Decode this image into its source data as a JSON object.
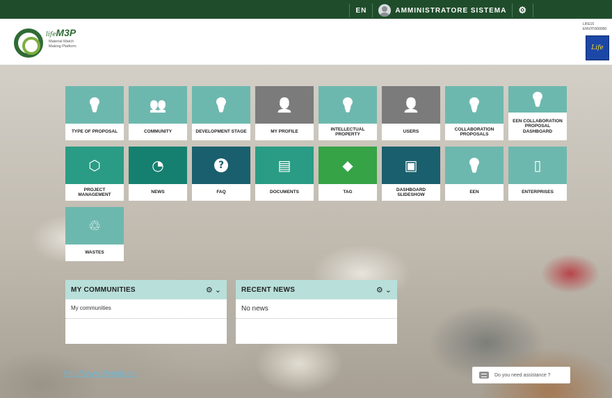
{
  "topbar": {
    "language": "EN",
    "user_name": "AMMINISTRATORE SISTEMA",
    "settings_icon": "gear-icon"
  },
  "header": {
    "logo_title": "M3P",
    "logo_prefix": "life",
    "logo_subtitle": "Material Match Making Platform",
    "eu_text": "LIFE15 ENV/IT/000000",
    "eu_flag_text": "Life"
  },
  "tiles": [
    {
      "label": "TYPE OF PROPOSAL",
      "icon": "lightbulb-icon",
      "color": "#6db8ae"
    },
    {
      "label": "COMMUNITY",
      "icon": "users-icon",
      "color": "#6db8ae"
    },
    {
      "label": "DEVELOPMENT STAGE",
      "icon": "lightbulb-icon",
      "color": "#6db8ae"
    },
    {
      "label": "MY PROFILE",
      "icon": "user-icon",
      "color": "#7b7b7b"
    },
    {
      "label": "INTELLECTUAL PROPERTY",
      "icon": "lightbulb-icon",
      "color": "#6db8ae"
    },
    {
      "label": "USERS",
      "icon": "user-group-icon",
      "color": "#7b7b7b"
    },
    {
      "label": "COLLABORATION PROPOSALS",
      "icon": "lightbulb-icon",
      "color": "#6db8ae"
    },
    {
      "label": "EEN COLLABORATION PROPOSAL DASHBOARD",
      "icon": "lightbulb-glow-icon",
      "color": "#6db8ae"
    },
    {
      "label": "PROJECT MANAGEMENT",
      "icon": "cubes-icon",
      "color": "#2a9c85"
    },
    {
      "label": "NEWS",
      "icon": "rss-icon",
      "color": "#15806f"
    },
    {
      "label": "FAQ",
      "icon": "question-icon",
      "color": "#1a5f6d"
    },
    {
      "label": "DOCUMENTS",
      "icon": "document-icon",
      "color": "#2a9c85"
    },
    {
      "label": "TAG",
      "icon": "tag-icon",
      "color": "#35a346"
    },
    {
      "label": "DASHBOARD SLIDESHOW",
      "icon": "image-icon",
      "color": "#1a5f6d"
    },
    {
      "label": "EEN",
      "icon": "lightbulb-glow-icon",
      "color": "#6db8ae"
    },
    {
      "label": "ENTERPRISES",
      "icon": "tablet-icon",
      "color": "#6db8ae"
    },
    {
      "label": "WASTES",
      "icon": "recycle-icon",
      "color": "#6db8ae"
    }
  ],
  "panels": {
    "communities": {
      "title": "MY COMMUNITIES",
      "body": "My communities"
    },
    "news": {
      "title": "RECENT NEWS",
      "body": "No news"
    }
  },
  "footer": {
    "link": "http://www.lifem3p.eu",
    "assist": "Do you need assistance ?"
  }
}
